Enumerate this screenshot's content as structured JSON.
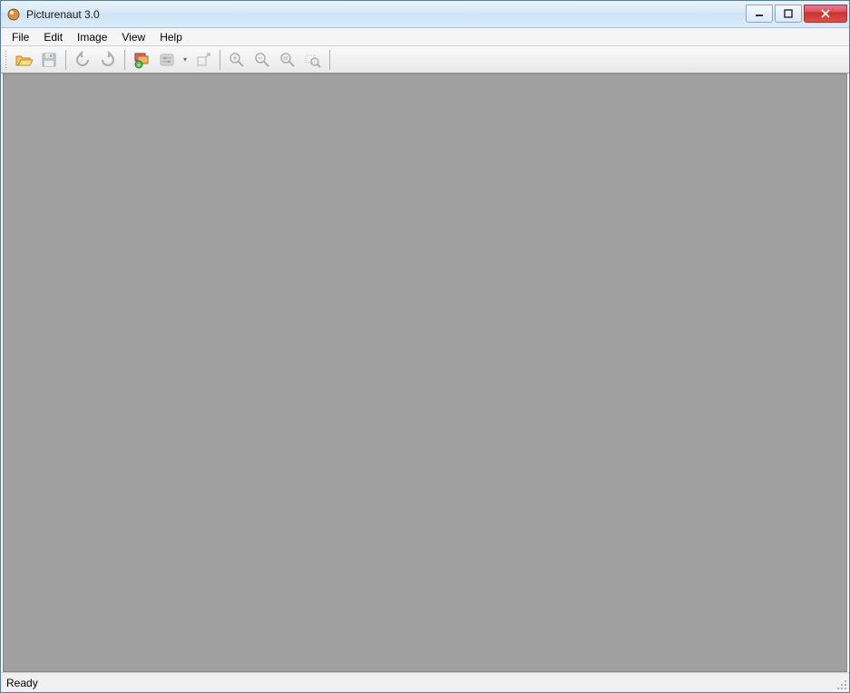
{
  "window": {
    "title": "Picturenaut 3.0"
  },
  "menu": {
    "file": "File",
    "edit": "Edit",
    "image": "Image",
    "view": "View",
    "help": "Help"
  },
  "toolbar": {
    "open": "open",
    "save": "save",
    "rotate_ccw": "rotate-ccw",
    "rotate_cw": "rotate-cw",
    "hdr": "hdr-generate",
    "tonemap": "tone-mapping",
    "fullscreen": "fullscreen",
    "zoom_in": "zoom-in",
    "zoom_out": "zoom-out",
    "zoom_fit": "zoom-fit",
    "zoom_actual": "zoom-actual"
  },
  "status": {
    "text": "Ready"
  }
}
